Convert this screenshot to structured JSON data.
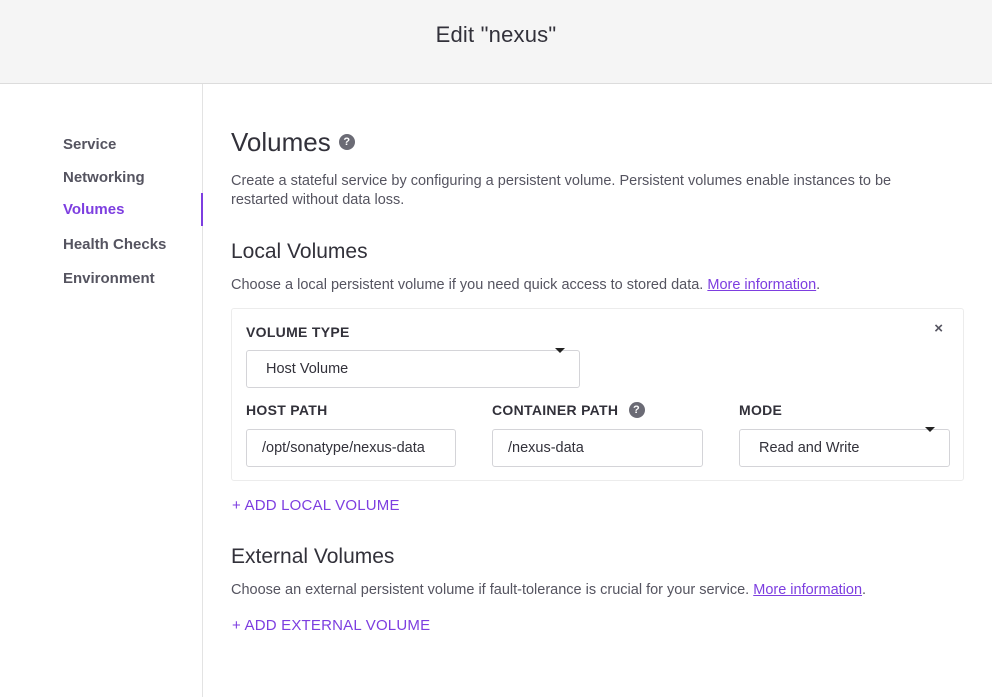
{
  "header": {
    "title": "Edit \"nexus\""
  },
  "sidebar": {
    "items": [
      {
        "label": "Service"
      },
      {
        "label": "Networking"
      },
      {
        "label": "Volumes"
      },
      {
        "label": "Health Checks"
      },
      {
        "label": "Environment"
      }
    ],
    "active": "Volumes"
  },
  "main": {
    "title": "Volumes",
    "description": "Create a stateful service by configuring a persistent volume. Persistent volumes enable instances to be restarted without data loss.",
    "local": {
      "title": "Local Volumes",
      "description": "Choose a local persistent volume if you need quick access to stored data. ",
      "more_info": "More information",
      "volume": {
        "volume_type_label": "VOLUME TYPE",
        "volume_type_value": "Host Volume",
        "host_path_label": "HOST PATH",
        "host_path_value": "/opt/sonatype/nexus-data",
        "container_path_label": "CONTAINER PATH",
        "container_path_value": "/nexus-data",
        "mode_label": "MODE",
        "mode_value": "Read and Write",
        "remove_symbol": "×"
      },
      "add_label": "+ ADD LOCAL VOLUME"
    },
    "external": {
      "title": "External Volumes",
      "description": "Choose an external persistent volume if fault-tolerance is crucial for your service. ",
      "more_info": "More information",
      "add_label": "+ ADD EXTERNAL VOLUME"
    }
  },
  "icons": {
    "help": "question-icon",
    "close": "close-icon",
    "caret": "caret-down-icon"
  },
  "colors": {
    "accent": "#7d3ee0",
    "text": "#32313a",
    "muted": "#555460",
    "header_bg": "#f5f5f5"
  }
}
